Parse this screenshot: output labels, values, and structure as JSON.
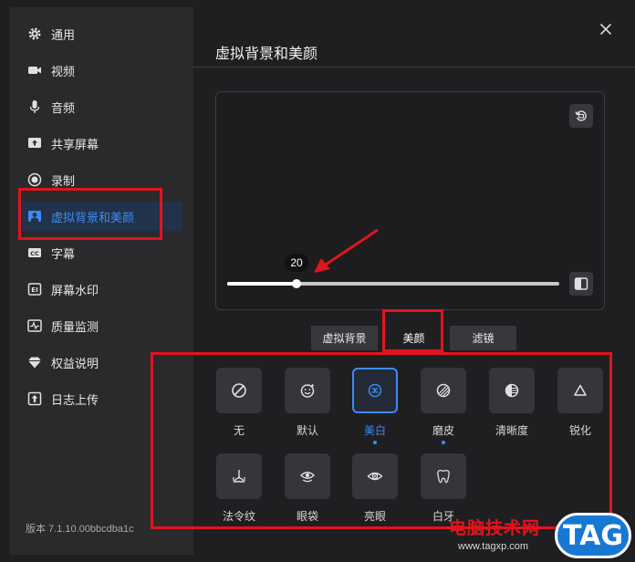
{
  "sidebar": {
    "items": [
      {
        "label": "通用",
        "icon": "gear-icon"
      },
      {
        "label": "视频",
        "icon": "video-icon"
      },
      {
        "label": "音频",
        "icon": "microphone-icon"
      },
      {
        "label": "共享屏幕",
        "icon": "share-screen-icon"
      },
      {
        "label": "录制",
        "icon": "record-icon"
      },
      {
        "label": "虚拟背景和美颜",
        "icon": "virtual-background-icon",
        "active": true
      },
      {
        "label": "字幕",
        "icon": "caption-icon"
      },
      {
        "label": "屏幕水印",
        "icon": "watermark-icon"
      },
      {
        "label": "质量监测",
        "icon": "quality-monitor-icon"
      },
      {
        "label": "权益说明",
        "icon": "diamond-icon"
      },
      {
        "label": "日志上传",
        "icon": "upload-log-icon"
      }
    ],
    "version": "版本 7.1.10.00bbcdba1c"
  },
  "main": {
    "title": "虚拟背景和美颜",
    "slider": {
      "value": "20",
      "fraction": 0.21
    },
    "tabs": [
      {
        "label": "虚拟背景"
      },
      {
        "label": "美颜",
        "active": true
      },
      {
        "label": "滤镜"
      }
    ],
    "effects": [
      {
        "label": "无",
        "icon": "none-icon"
      },
      {
        "label": "默认",
        "icon": "smile-icon"
      },
      {
        "label": "美白",
        "icon": "whitening-icon",
        "selected": true,
        "modified": true
      },
      {
        "label": "磨皮",
        "icon": "smoothing-icon",
        "modified": true
      },
      {
        "label": "清晰度",
        "icon": "clarity-icon"
      },
      {
        "label": "锐化",
        "icon": "sharpen-icon"
      },
      {
        "label": "法令纹",
        "icon": "nose-icon"
      },
      {
        "label": "眼袋",
        "icon": "eye-bag-icon"
      },
      {
        "label": "亮眼",
        "icon": "eye-icon"
      },
      {
        "label": "白牙",
        "icon": "tooth-icon"
      }
    ]
  },
  "watermark": {
    "text": "电脑技术网",
    "url": "www.tagxp.com",
    "badge": "TAG"
  },
  "colors": {
    "accent": "#3d8bf5",
    "annotation": "#e0141e",
    "sidebar_bg": "#2a2a2d",
    "main_bg": "#1f1f22"
  }
}
